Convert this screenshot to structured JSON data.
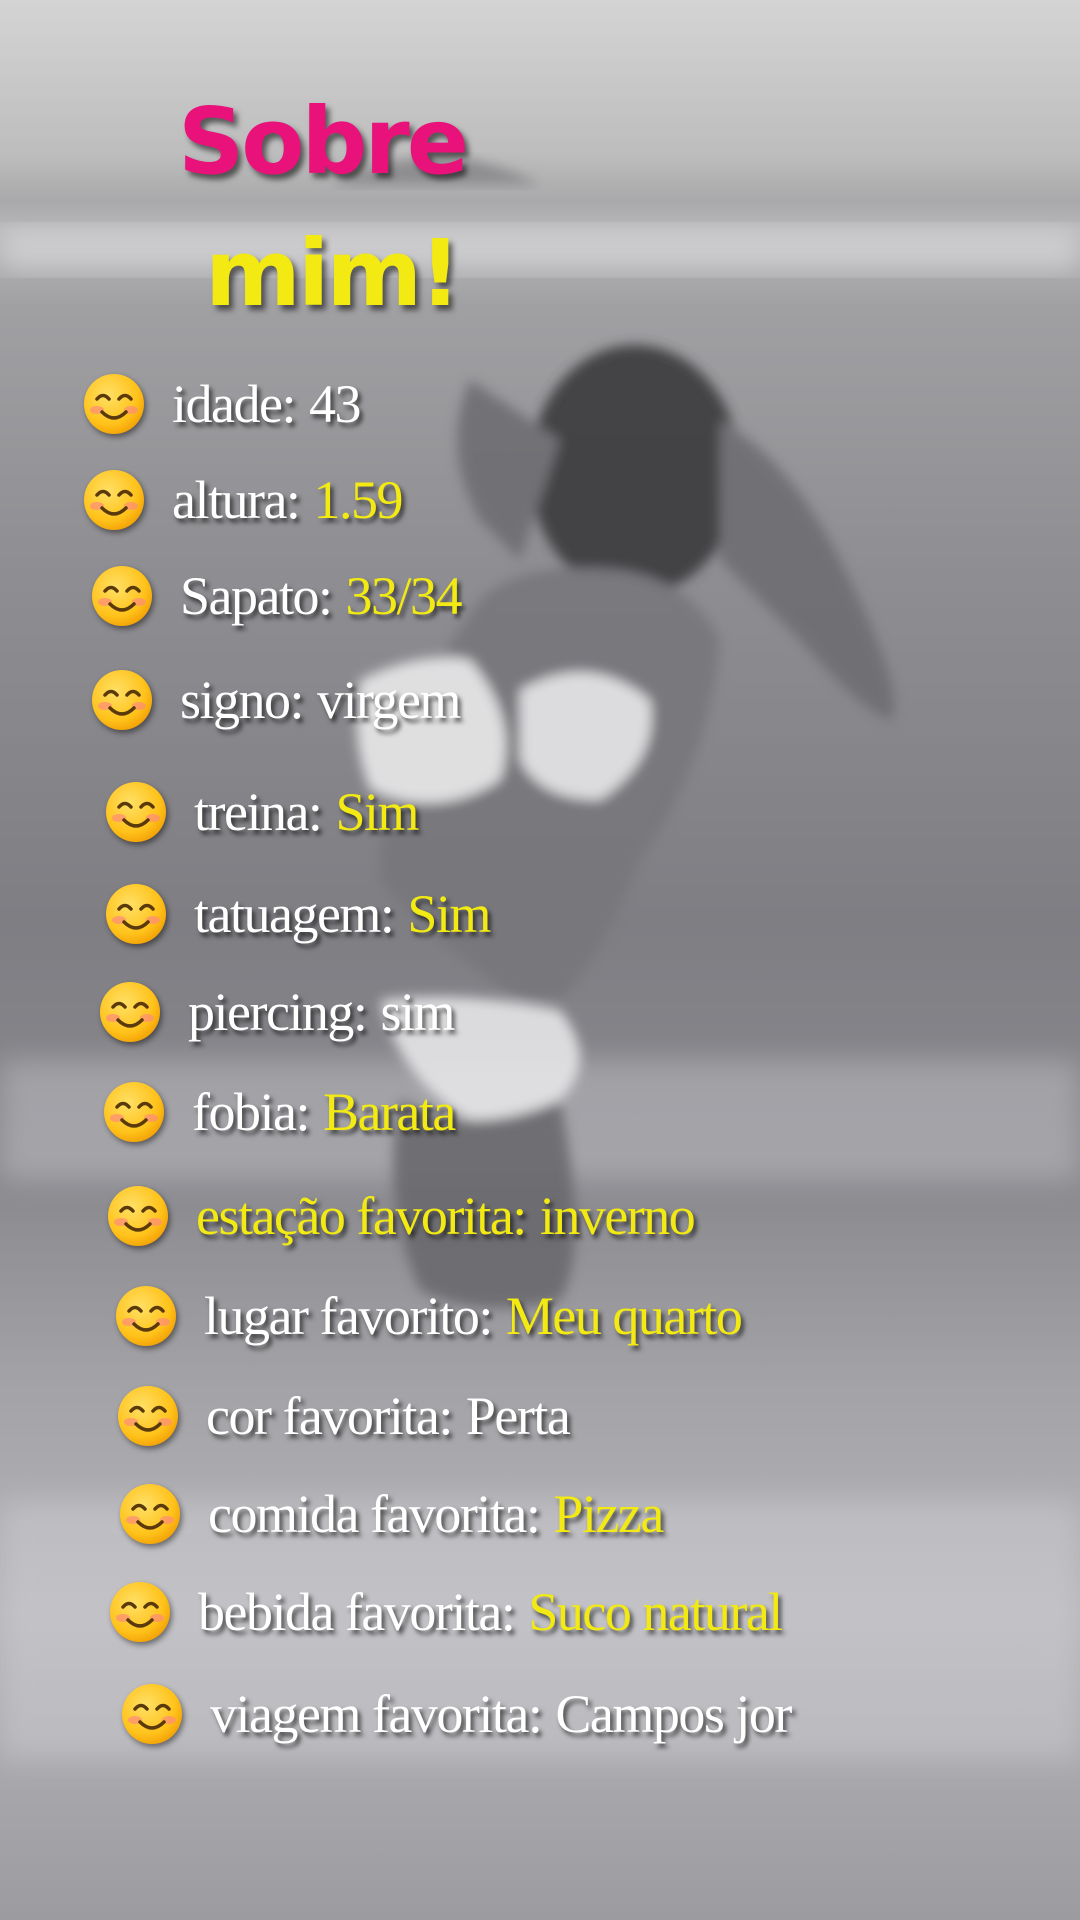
{
  "title": {
    "line1": "Sobre",
    "line2": "mim!"
  },
  "colors": {
    "title_pink": "#e8127a",
    "title_yellow": "#f2ea12",
    "text_white": "#ffffff",
    "highlight_yellow": "#f2ea12"
  },
  "icon": "smiling-face-emoji-icon",
  "items": [
    {
      "label": "idade:",
      "value": "43",
      "value_color": "white"
    },
    {
      "label": "altura:",
      "value": "1.59",
      "value_color": "yellow"
    },
    {
      "label": "Sapato:",
      "value": "33/34",
      "value_color": "yellow"
    },
    {
      "label": "signo:",
      "value": "virgem",
      "value_color": "white"
    },
    {
      "label": "treina:",
      "value": "Sim",
      "value_color": "yellow"
    },
    {
      "label": "tatuagem:",
      "value": "Sim",
      "value_color": "yellow"
    },
    {
      "label": "piercing:",
      "value": "sim",
      "value_color": "white"
    },
    {
      "label": "fobia:",
      "value": "Barata",
      "value_color": "yellow"
    },
    {
      "label": "estação favorita:",
      "value": "inverno",
      "value_color": "yellow",
      "label_color": "yellow"
    },
    {
      "label": "lugar favorito:",
      "value": "Meu quarto",
      "value_color": "yellow"
    },
    {
      "label": "cor favorita:",
      "value": "Perta",
      "value_color": "white"
    },
    {
      "label": "comida favorita:",
      "value": "Pizza",
      "value_color": "yellow"
    },
    {
      "label": "bebida favorita:",
      "value": "Suco natural",
      "value_color": "yellow"
    },
    {
      "label": "viagem  favorita:",
      "value": "Campos jor",
      "value_color": "white"
    }
  ]
}
